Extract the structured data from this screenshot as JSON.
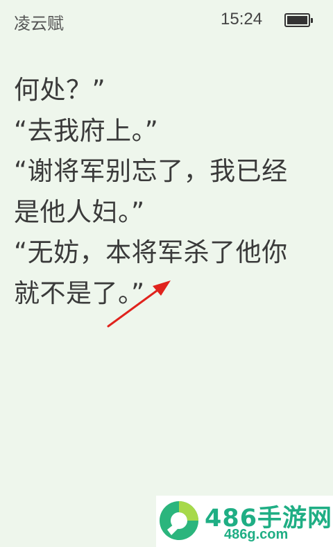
{
  "status": {
    "book_title": "凌云赋",
    "time": "15:24",
    "battery_level": 1.0
  },
  "reader": {
    "lines": [
      "何处？”",
      "“去我府上。”",
      "“谢将军别忘了，我已经",
      "是他人妇。”",
      "“无妨，本将军杀了他你",
      "就不是了。”"
    ]
  },
  "annotation": {
    "icon": "red-arrow-icon",
    "color": "#e0231d"
  },
  "watermark": {
    "brand": "486手游网",
    "domain": "486g.com",
    "color": "#1fae84"
  }
}
